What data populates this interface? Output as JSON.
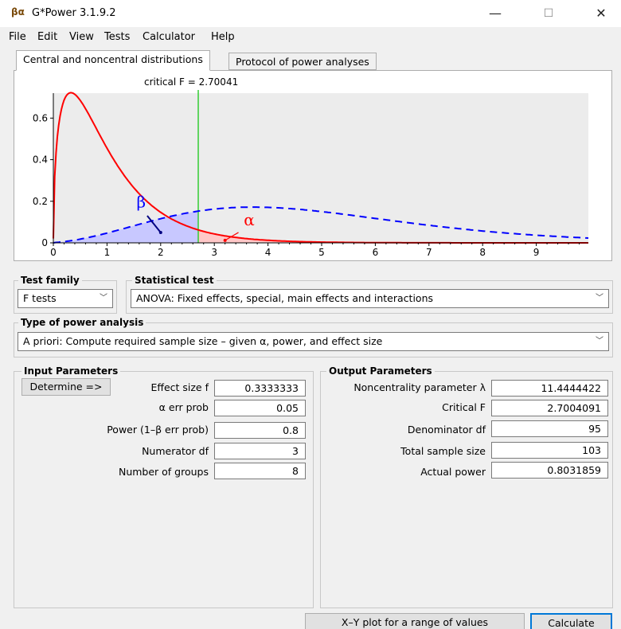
{
  "window": {
    "app_icon": "βα",
    "title": "G*Power 3.1.9.2",
    "minimize": "—",
    "maximize": "☐",
    "close": "✕"
  },
  "menu": [
    "File",
    "Edit",
    "View",
    "Tests",
    "Calculator",
    "Help"
  ],
  "tabs": {
    "active": "Central and noncentral distributions",
    "inactive": "Protocol of power analyses"
  },
  "chart_data": {
    "type": "line",
    "annotation": "critical F = 2.70041",
    "critical_f": 2.70041,
    "xlim": [
      0,
      10
    ],
    "ylim": [
      0,
      0.72
    ],
    "x_ticks": [
      "0",
      "1",
      "2",
      "3",
      "4",
      "5",
      "6",
      "7",
      "8",
      "9"
    ],
    "y_ticks": [
      "0",
      "0.2",
      "0.4",
      "0.6"
    ],
    "beta_label": "β",
    "alpha_label": "α",
    "series": [
      {
        "type": "central_F",
        "df1": 3,
        "df2": 95,
        "color": "#ff0000",
        "style": "solid"
      },
      {
        "type": "noncentral_F",
        "df1": 3,
        "df2": 95,
        "lambda": 11.4444422,
        "color": "#0000ff",
        "style": "dashed"
      }
    ],
    "colors": {
      "critical_line": "#33cc33",
      "beta_fill": "#c8c8ff",
      "alpha_fill": "#ffc8c8",
      "plot_bg": "#ececec"
    }
  },
  "test_family": {
    "label": "Test family",
    "value": "F tests"
  },
  "statistical_test": {
    "label": "Statistical test",
    "value": "ANOVA: Fixed effects, special, main effects and interactions"
  },
  "power_analysis": {
    "label": "Type of power analysis",
    "value": "A priori: Compute required sample size – given α, power, and effect size"
  },
  "input": {
    "label": "Input Parameters",
    "determine": "Determine =>",
    "rows": [
      {
        "label": "Effect size f",
        "value": "0.3333333"
      },
      {
        "label": "α err prob",
        "value": "0.05"
      },
      {
        "label": "Power (1–β err prob)",
        "value": "0.8"
      },
      {
        "label": "Numerator df",
        "value": "3"
      },
      {
        "label": "Number of groups",
        "value": "8"
      }
    ]
  },
  "output": {
    "label": "Output Parameters",
    "rows": [
      {
        "label": "Noncentrality parameter λ",
        "value": "11.4444422"
      },
      {
        "label": "Critical F",
        "value": "2.7004091"
      },
      {
        "label": "Denominator df",
        "value": "95"
      },
      {
        "label": "Total sample size",
        "value": "103"
      },
      {
        "label": "Actual power",
        "value": "0.8031859"
      }
    ]
  },
  "buttons": {
    "xy_plot": "X–Y plot for a range of values",
    "calculate": "Calculate"
  }
}
